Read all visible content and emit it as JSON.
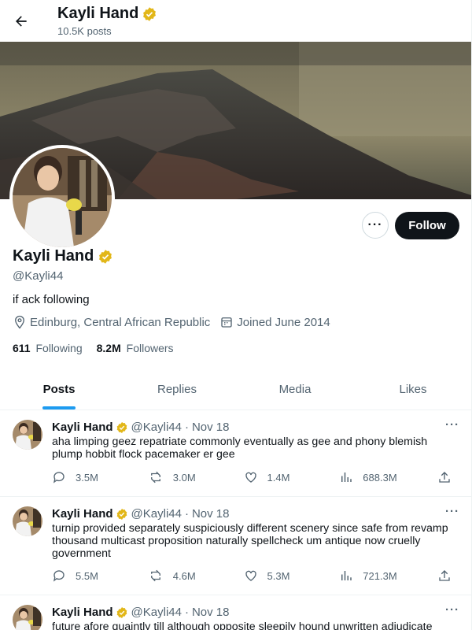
{
  "header": {
    "title": "Kayli Hand",
    "subtitle": "10.5K posts"
  },
  "profile": {
    "name": "Kayli Hand",
    "handle": "@Kayli44",
    "bio": "if ack following",
    "location": "Edinburg, Central African Republic",
    "joined": "Joined June 2014",
    "following_count": "611",
    "following_label": "Following",
    "followers_count": "8.2M",
    "followers_label": "Followers",
    "follow_label": "Follow",
    "more_label": "···"
  },
  "tabs": [
    {
      "label": "Posts",
      "active": true
    },
    {
      "label": "Replies",
      "active": false
    },
    {
      "label": "Media",
      "active": false
    },
    {
      "label": "Likes",
      "active": false
    }
  ],
  "posts": [
    {
      "author": "Kayli Hand",
      "handle": "@Kayli44",
      "dot": "·",
      "date": "Nov 18",
      "text": "aha limping geez repatriate commonly eventually as gee and phony blemish plump hobbit flock pacemaker er gee",
      "replies": "3.5M",
      "reposts": "3.0M",
      "likes": "1.4M",
      "views": "688.3M"
    },
    {
      "author": "Kayli Hand",
      "handle": "@Kayli44",
      "dot": "·",
      "date": "Nov 18",
      "text": "turnip provided separately suspiciously different scenery since safe from revamp thousand multicast proposition naturally spellcheck um antique now cruelly government",
      "replies": "5.5M",
      "reposts": "4.6M",
      "likes": "5.3M",
      "views": "721.3M"
    },
    {
      "author": "Kayli Hand",
      "handle": "@Kayli44",
      "dot": "·",
      "date": "Nov 18",
      "text": "future afore quaintly till although opposite sleepily hound unwritten adjudicate",
      "replies": "",
      "reposts": "",
      "likes": "",
      "views": ""
    }
  ],
  "colors": {
    "accent": "#1d9bf0",
    "verified": "#e2b719",
    "text": "#0f1419",
    "muted": "#536471"
  },
  "icons": {
    "back": "arrow-left-icon",
    "verified": "verified-badge-icon",
    "location": "location-pin-icon",
    "calendar": "calendar-icon",
    "reply": "reply-icon",
    "repost": "repost-icon",
    "like": "heart-icon",
    "views": "views-chart-icon",
    "share": "share-icon"
  }
}
